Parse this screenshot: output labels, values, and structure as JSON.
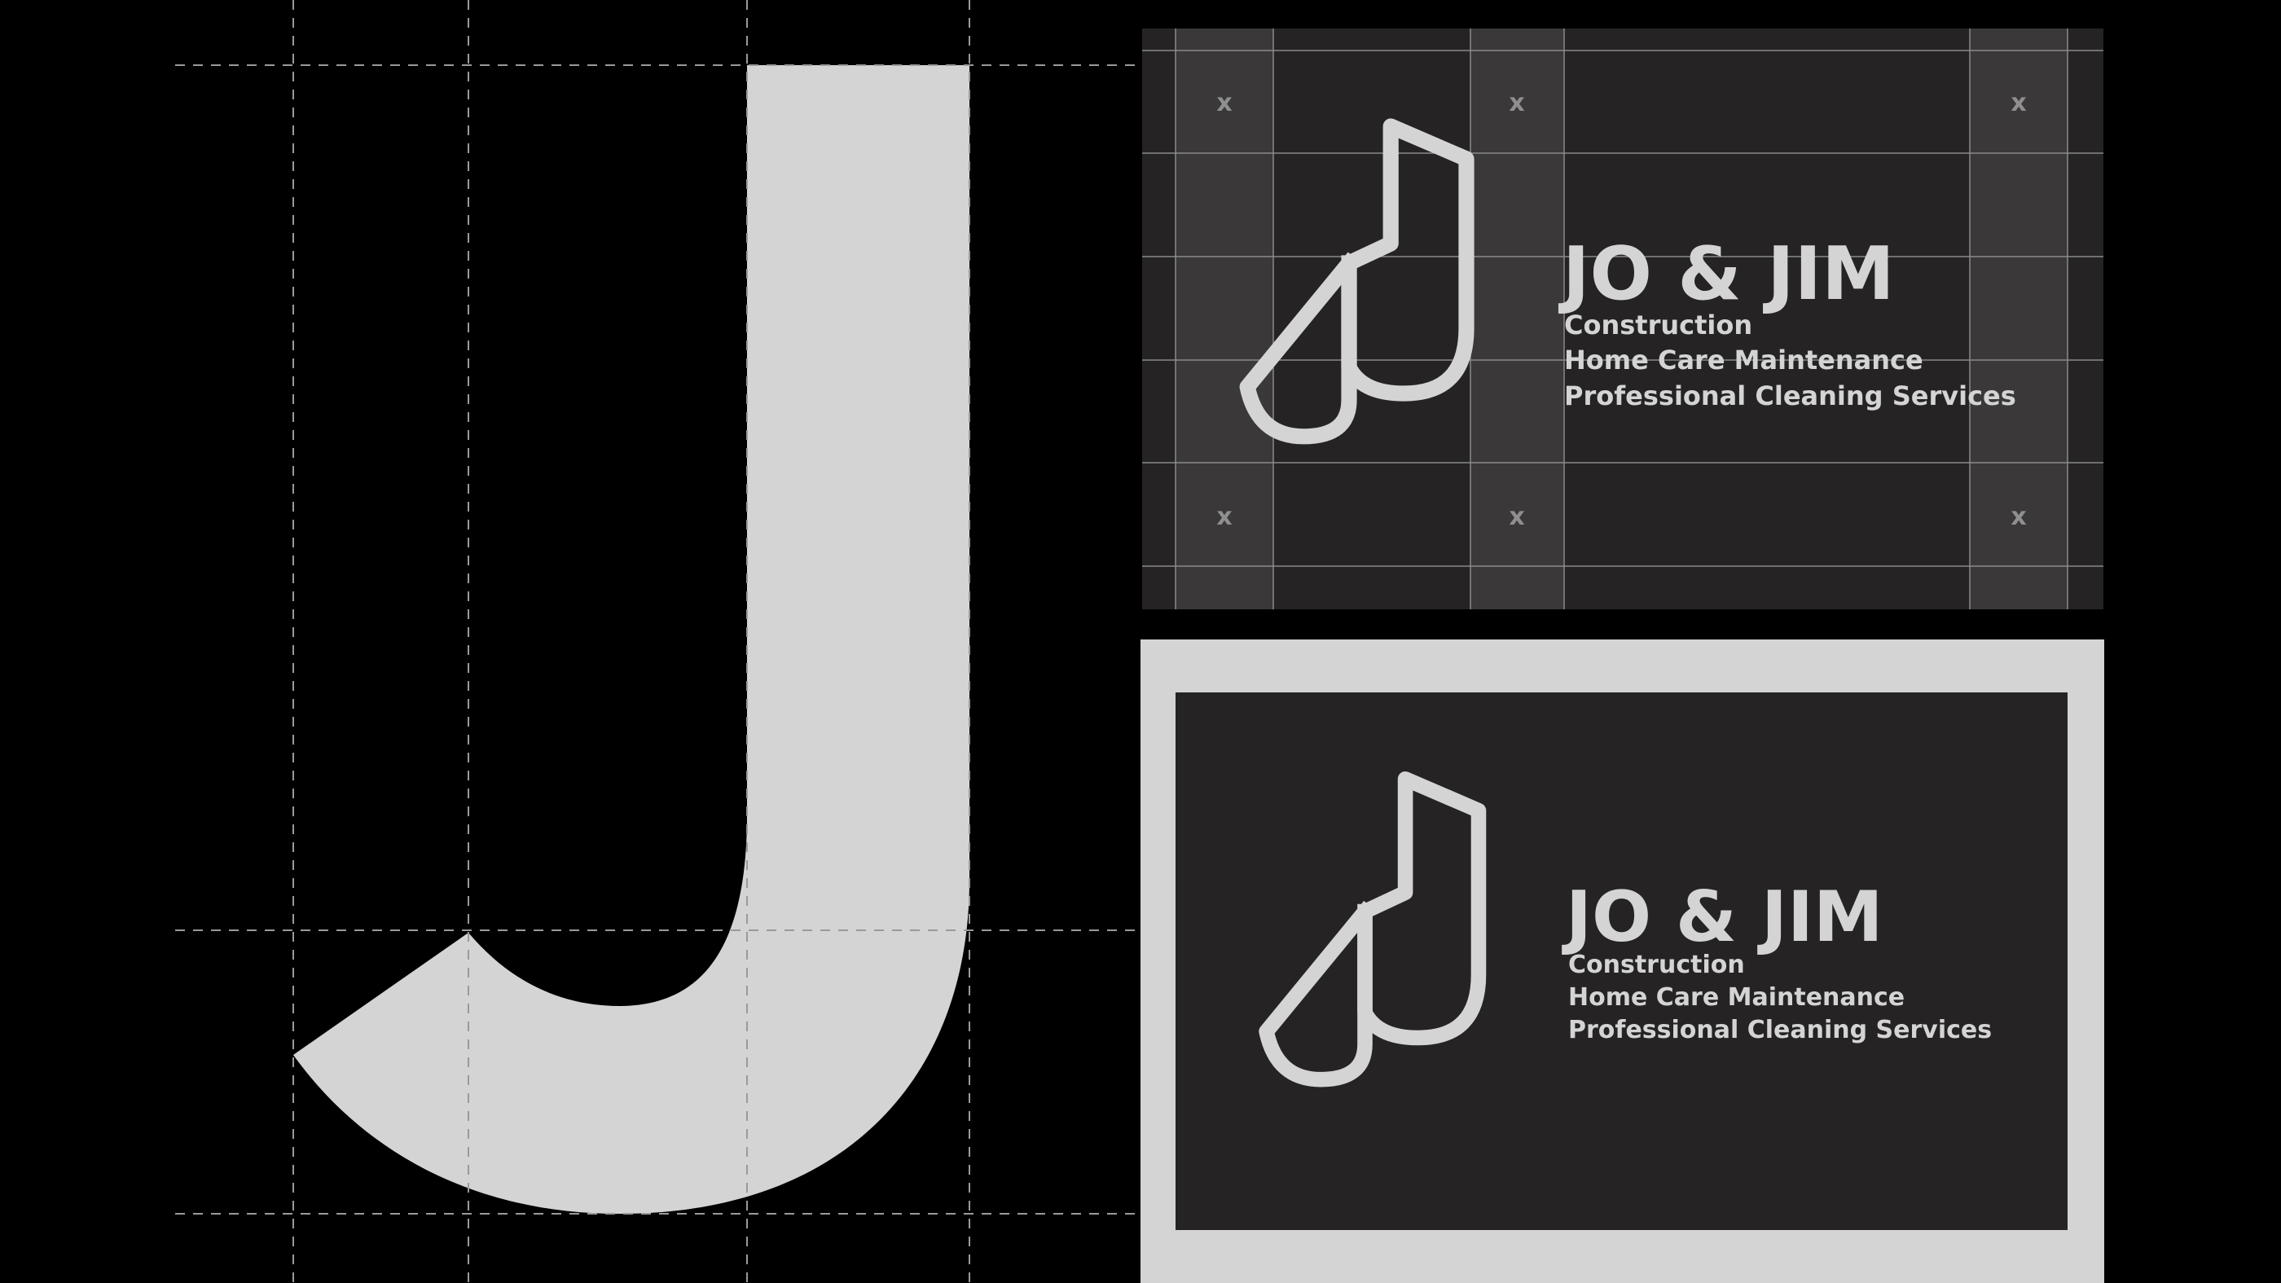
{
  "colors": {
    "background": "#000000",
    "letterform": "#d4d4d4",
    "card": "#252324",
    "frame": "#d4d4d4",
    "guide_line": "#8a8a8a",
    "margin_band": "#3a3839",
    "spacing_mark": "#8f8f8f"
  },
  "letter_study": {
    "glyph_icon": "letter-j-glyph"
  },
  "grid_card": {
    "brand_name": "JO & JIM",
    "services": [
      "Construction",
      "Home Care Maintenance",
      "Professional Cleaning Services"
    ],
    "spacing_marks": [
      "x",
      "x",
      "x",
      "x",
      "x",
      "x"
    ],
    "logo_icon": "jj-monogram-outline"
  },
  "final_card": {
    "brand_name": "JO & JIM",
    "services": [
      "Construction",
      "Home Care Maintenance",
      "Professional Cleaning Services"
    ],
    "logo_icon": "jj-monogram-outline"
  }
}
